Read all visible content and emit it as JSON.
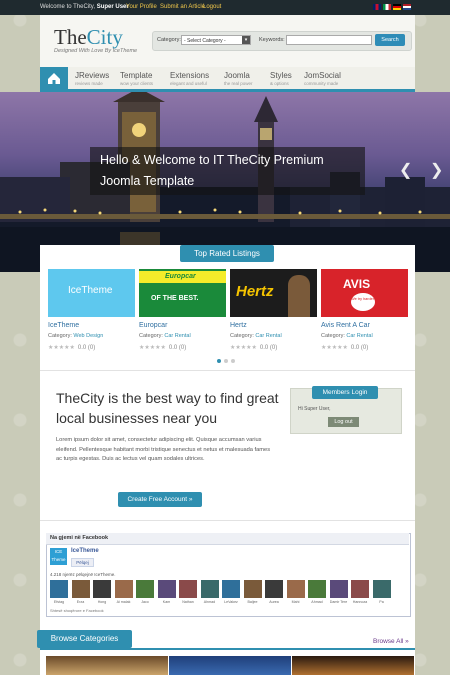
{
  "topbar": {
    "welcome_prefix": "Welcome to TheCity,",
    "welcome_user": "Super User",
    "links": [
      "Your Profile",
      "Submit an Article",
      "Logout"
    ]
  },
  "header": {
    "logo_the": "The",
    "logo_city": "City",
    "tagline": "Designed With Love By IceTheme"
  },
  "search": {
    "category_label": "Category:",
    "category_value": "- Select Category -",
    "keywords_label": "Keywords:",
    "button": "Search"
  },
  "nav": [
    {
      "title": "JReviews",
      "sub": "reviews made"
    },
    {
      "title": "Template",
      "sub": "wow your clients"
    },
    {
      "title": "Extensions",
      "sub": "elegant and useful"
    },
    {
      "title": "Joomla",
      "sub": "the real power"
    },
    {
      "title": "Styles",
      "sub": "& options"
    },
    {
      "title": "JomSocial",
      "sub": "community made"
    }
  ],
  "hero": {
    "line1": "Hello & Welcome to IT TheCity Premium",
    "line2": "Joomla Template"
  },
  "top_rated": {
    "heading": "Top Rated Listings",
    "category_prefix": "Category:",
    "items": [
      {
        "title": "IceTheme",
        "category": "Web Design",
        "rating": "0.0 (0)",
        "logo_text": "IceTheme",
        "color": "#5ec8ee"
      },
      {
        "title": "Europcar",
        "category": "Car Rental",
        "rating": "0.0 (0)",
        "logo_text": "Europcar",
        "tag": "OF THE BEST.",
        "color": "#1a8a3a"
      },
      {
        "title": "Hertz",
        "category": "Car Rental",
        "rating": "0.0 (0)",
        "logo_text": "Hertz",
        "color": "#f5c400"
      },
      {
        "title": "Avis Rent A Car",
        "category": "Car Rental",
        "rating": "0.0 (0)",
        "logo_text": "AVIS",
        "tag": "We try harder.",
        "color": "#d8232a"
      }
    ]
  },
  "promo": {
    "title": "TheCity is the best way to find great local businesses near you",
    "text": "Lorem ipsum dolor sit amet, consectetur adipiscing elit. Quisque accumsan varius eleifend. Pellentesque habitant morbi tristique senectus et netus et malesuada fames ac turpis egestas. Duis ac lectus vel quam sodales ultrices.",
    "button": "Create Free Account »"
  },
  "members": {
    "heading": "Members Login",
    "greeting": "Hi Super User,",
    "logout": "Log out"
  },
  "facebook": {
    "title": "Na gjemi në Facebook",
    "page_name": "IceTheme",
    "logo_text": "ICE Theme",
    "like": "Pëlqej",
    "count_text": "4.218 njerëz pëlqejnë IceTheme.",
    "plugin_text": "Shtesë shoqërore e Facebook",
    "fans": [
      "Efstag",
      "Erza",
      "Hong",
      "Ai malak",
      "Jaco",
      "Kam",
      "Nathan",
      "Ahmad",
      "LeVakez",
      "Baljee",
      "Aurea",
      "Mahi",
      "Ahmad",
      "Damir Tere",
      "Hannoza",
      "Pa"
    ]
  },
  "browse": {
    "heading": "Browse Categories",
    "all_link": "Browse All »"
  },
  "colors": {
    "accent": "#2f8fb0",
    "topbar": "#1f2a2f",
    "link_yellow": "#f2c84b"
  }
}
